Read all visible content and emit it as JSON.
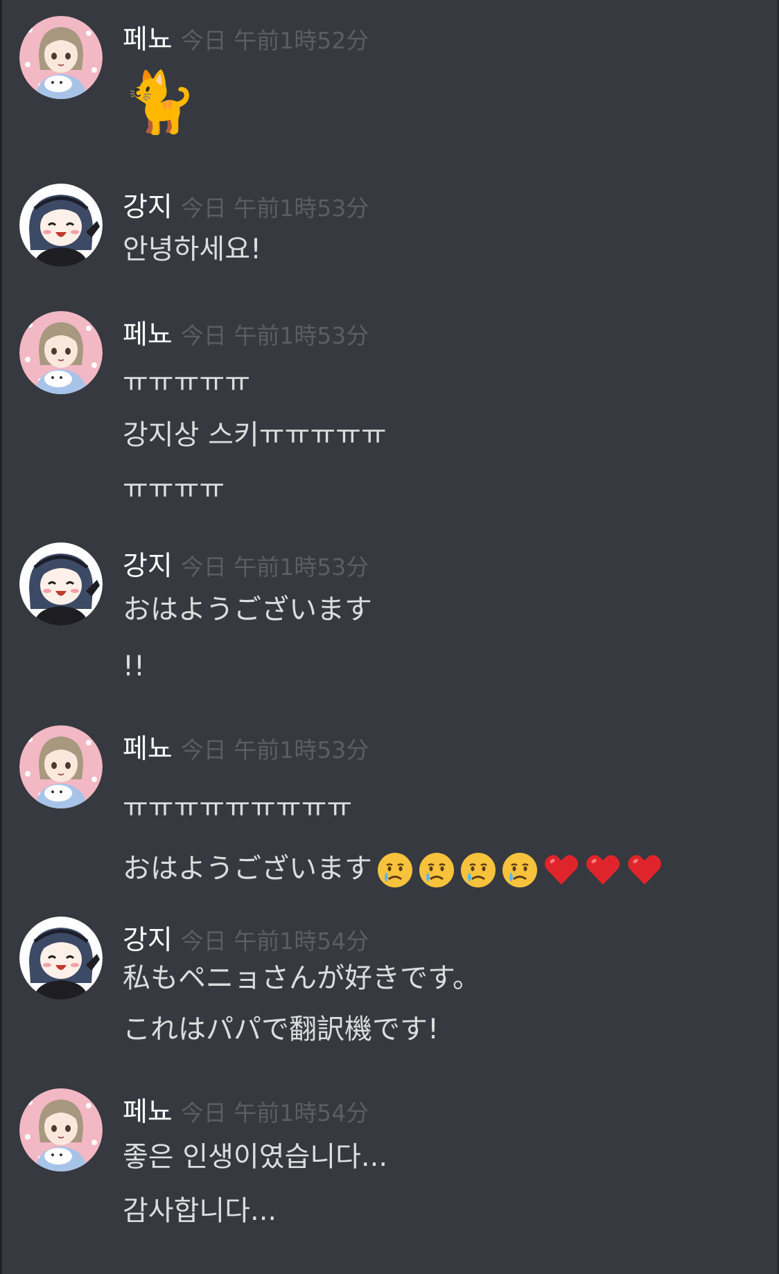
{
  "messages": [
    {
      "author": "페뇨",
      "avatar": "pink-girl-avatar",
      "timestamp": "今日 午前1時52分",
      "lines": [
        {
          "emoji": "🐈"
        }
      ]
    },
    {
      "author": "강지",
      "avatar": "dark-hair-avatar",
      "timestamp": "今日 午前1時53分",
      "lines": [
        {
          "text": "안녕하세요!"
        }
      ]
    },
    {
      "author": "페뇨",
      "avatar": "pink-girl-avatar",
      "timestamp": "今日 午前1時53分",
      "lines": [
        {
          "text": "ㅠㅠㅠㅠㅠ"
        },
        {
          "text": "강지상 스키ㅠㅠㅠㅠㅠ"
        },
        {
          "text": "ㅠㅠㅠㅠ"
        }
      ]
    },
    {
      "author": "강지",
      "avatar": "dark-hair-avatar",
      "timestamp": "今日 午前1時53分",
      "lines": [
        {
          "text": "おはようございます"
        },
        {
          "text": "!!"
        }
      ]
    },
    {
      "author": "페뇨",
      "avatar": "pink-girl-avatar",
      "timestamp": "今日 午前1時53分",
      "lines": [
        {
          "text": "ㅠㅠㅠㅠㅠㅠㅠㅠㅠ"
        },
        {
          "text": "おはようございます",
          "emojis": [
            "crying-face",
            "crying-face",
            "crying-face",
            "crying-face",
            "red-heart",
            "red-heart",
            "red-heart"
          ]
        }
      ]
    },
    {
      "author": "강지",
      "avatar": "dark-hair-avatar",
      "timestamp": "今日 午前1時54分",
      "lines": [
        {
          "text": "私もペニョさんが好きです。"
        },
        {
          "text": "これはパパで翻訳機です!"
        }
      ]
    },
    {
      "author": "페뇨",
      "avatar": "pink-girl-avatar",
      "timestamp": "今日 午前1時54分",
      "lines": [
        {
          "text": "좋은 인생이였습니다..."
        },
        {
          "text": "감사합니다..."
        }
      ]
    }
  ],
  "colors": {
    "background": "#36393f",
    "username": "#ffffff",
    "timestamp": "#5b5e65",
    "message_text": "#dcddde"
  }
}
